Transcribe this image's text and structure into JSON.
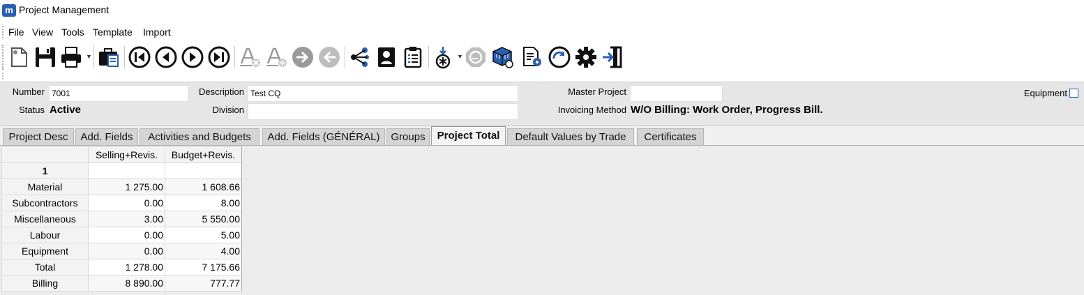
{
  "window": {
    "title": "Project Management",
    "icon": "app-logo-icon"
  },
  "menu": [
    "File",
    "View",
    "Tools",
    "Template",
    "Import"
  ],
  "toolbar": [
    {
      "name": "new-document-icon"
    },
    {
      "name": "save-icon"
    },
    {
      "name": "print-icon"
    },
    {
      "name": "briefcase-icon"
    },
    {
      "name": "first-record-icon"
    },
    {
      "name": "previous-record-icon"
    },
    {
      "name": "next-record-icon"
    },
    {
      "name": "last-record-icon"
    },
    {
      "name": "font-delete-icon"
    },
    {
      "name": "font-add-icon"
    },
    {
      "name": "forward-arrow-icon"
    },
    {
      "name": "back-arrow-icon"
    },
    {
      "name": "share-icon"
    },
    {
      "name": "contact-card-icon"
    },
    {
      "name": "clipboard-list-icon"
    },
    {
      "name": "download-star-icon"
    },
    {
      "name": "return-gray-icon"
    },
    {
      "name": "cube-refresh-icon"
    },
    {
      "name": "document-settings-icon"
    },
    {
      "name": "refresh-circle-icon"
    },
    {
      "name": "gear-icon"
    },
    {
      "name": "exit-icon"
    }
  ],
  "header": {
    "number_label": "Number",
    "number_value": "7001",
    "description_label": "Description",
    "description_value": "Test CQ",
    "master_project_label": "Master Project",
    "master_project_value": "",
    "equipment_label": "Equipment",
    "equipment_checked": false,
    "status_label": "Status",
    "status_value": "Active",
    "division_label": "Division",
    "division_value": "",
    "invoicing_label": "Invoicing Method",
    "invoicing_value": "W/O Billing: Work Order, Progress Bill."
  },
  "tabs": [
    {
      "label": "Project Desc",
      "active": false
    },
    {
      "label": "Add. Fields",
      "active": false
    },
    {
      "label": "Activities and Budgets",
      "active": false
    },
    {
      "label": "Add. Fields (GÉNÉRAL)",
      "active": false
    },
    {
      "label": "Groups",
      "active": false
    },
    {
      "label": "Project Total",
      "active": true
    },
    {
      "label": "Default Values by Trade",
      "active": false
    },
    {
      "label": "Certificates",
      "active": false
    }
  ],
  "grid": {
    "columns": [
      "Selling+Revis.",
      "Budget+Revis."
    ],
    "group_label": "1",
    "rows": [
      {
        "label": "Material",
        "values": [
          "1 275.00",
          "1 608.66"
        ]
      },
      {
        "label": "Subcontractors",
        "values": [
          "0.00",
          "8.00"
        ]
      },
      {
        "label": "Miscellaneous",
        "values": [
          "3.00",
          "5 550.00"
        ]
      },
      {
        "label": "Labour",
        "values": [
          "0.00",
          "5.00"
        ]
      },
      {
        "label": "Equipment",
        "values": [
          "0.00",
          "4.00"
        ]
      },
      {
        "label": "Total",
        "values": [
          "1 278.00",
          "7 175.66"
        ]
      },
      {
        "label": "Billing",
        "values": [
          "8 890.00",
          "777.77"
        ]
      }
    ]
  },
  "colors": {
    "accent": "#2a5fb0",
    "panel": "#e6e6e6",
    "tab": "#d4d4d4"
  }
}
